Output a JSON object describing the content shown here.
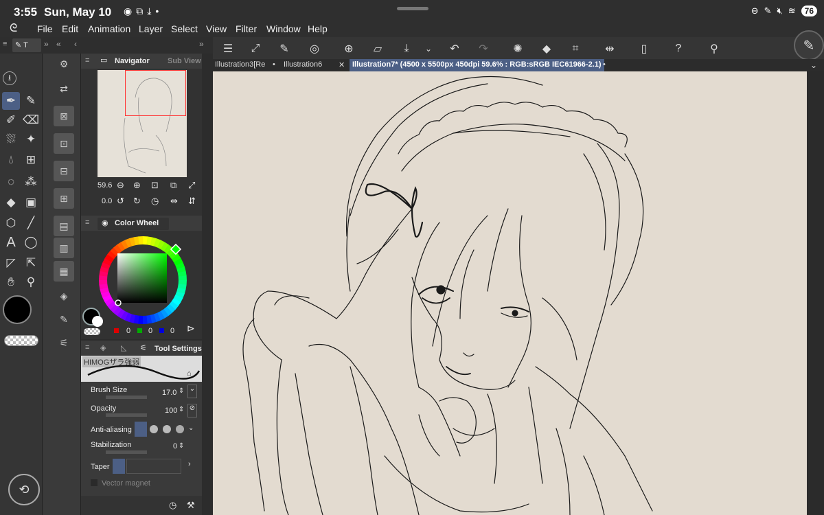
{
  "status": {
    "time": "3:55",
    "date": "Sun, May 10",
    "battery": "76"
  },
  "menu": [
    "File",
    "Edit",
    "Animation",
    "Layer",
    "Select",
    "View",
    "Filter",
    "Window",
    "Help"
  ],
  "tabs": [
    {
      "label": "Illustration3[Re"
    },
    {
      "label": "Illustration6"
    },
    {
      "label": "Illustration7* (4500 x 5500px 450dpi 59.6% : RGB:sRGB IEC61966-2.1)"
    }
  ],
  "navigator": {
    "title": "Navigator",
    "subview": "Sub View",
    "zoom": "59.6",
    "rotation": "0.0"
  },
  "colorwheel": {
    "title": "Color Wheel",
    "r": "0",
    "g": "0",
    "b": "0"
  },
  "toolsettings": {
    "title": "Tool Settings",
    "brush_name": "HIMOGザラ強弱",
    "brush_size_label": "Brush Size",
    "brush_size_value": "17.0",
    "opacity_label": "Opacity",
    "opacity_value": "100",
    "antialias_label": "Anti-aliasing",
    "stabilization_label": "Stabilization",
    "stabilization_value": "0",
    "taper_label": "Taper",
    "vector_magnet_label": "Vector magnet"
  },
  "colors": {
    "accent": "#4c5f85",
    "canvas": "#e3dbd0",
    "primary_color": "#000000",
    "selection": "#ff3333"
  }
}
